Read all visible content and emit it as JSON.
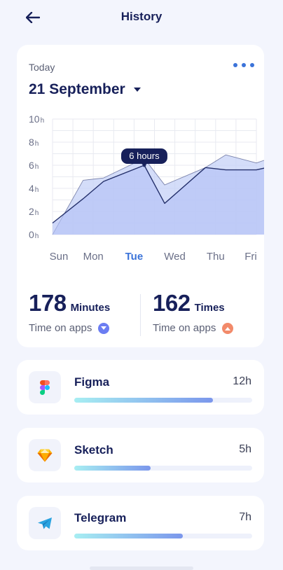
{
  "header": {
    "title": "History",
    "back_icon": "arrow-left-icon"
  },
  "summary": {
    "period_label": "Today",
    "date": "21 September",
    "menu_icon": "more-dots-icon"
  },
  "chart_data": {
    "type": "area",
    "categories": [
      "Sun",
      "Mon",
      "Tue",
      "Wed",
      "Thu",
      "Fri"
    ],
    "highlighted_category": "Tue",
    "y_tick_labels": [
      "10h",
      "8h",
      "6h",
      "4h",
      "2h",
      "0h"
    ],
    "ylim": [
      0,
      10
    ],
    "x": [
      0,
      0.75,
      1.25,
      2.25,
      2.75,
      3.75,
      4.25,
      5,
      5.5,
      5.9
    ],
    "series": [
      {
        "values": [
          0,
          4.7,
          4.9,
          6.6,
          4.3,
          5.8,
          6.9,
          6.2,
          6.8,
          6.6
        ]
      },
      {
        "values": [
          1.0,
          3.1,
          4.6,
          6.0,
          2.7,
          5.8,
          5.6,
          5.6,
          6.0,
          6.0
        ]
      }
    ],
    "tooltip": {
      "label": "6 hours",
      "x": 2.25,
      "y": 6.0
    },
    "grid": true,
    "colors": {
      "area_back": "#c5d2f7",
      "area_front": "#b4c2f6",
      "line": "#24306b",
      "tooltip_bg": "#17205a",
      "accent": "#3b73d9"
    }
  },
  "stats": [
    {
      "value": "178",
      "unit": "Minutes",
      "label": "Time on apps",
      "trend_icon": "chevron-down-icon",
      "trend_color": "#6b7df2"
    },
    {
      "value": "162",
      "unit": "Times",
      "label": "Time on apps",
      "trend_icon": "chevron-up-icon",
      "trend_color": "#f28a6a"
    }
  ],
  "apps": [
    {
      "name": "Figma",
      "hours": "12h",
      "usage_fraction": 0.78,
      "icon": "figma-icon"
    },
    {
      "name": "Sketch",
      "hours": "5h",
      "usage_fraction": 0.43,
      "icon": "sketch-icon"
    },
    {
      "name": "Telegram",
      "hours": "7h",
      "usage_fraction": 0.61,
      "icon": "telegram-icon"
    }
  ]
}
